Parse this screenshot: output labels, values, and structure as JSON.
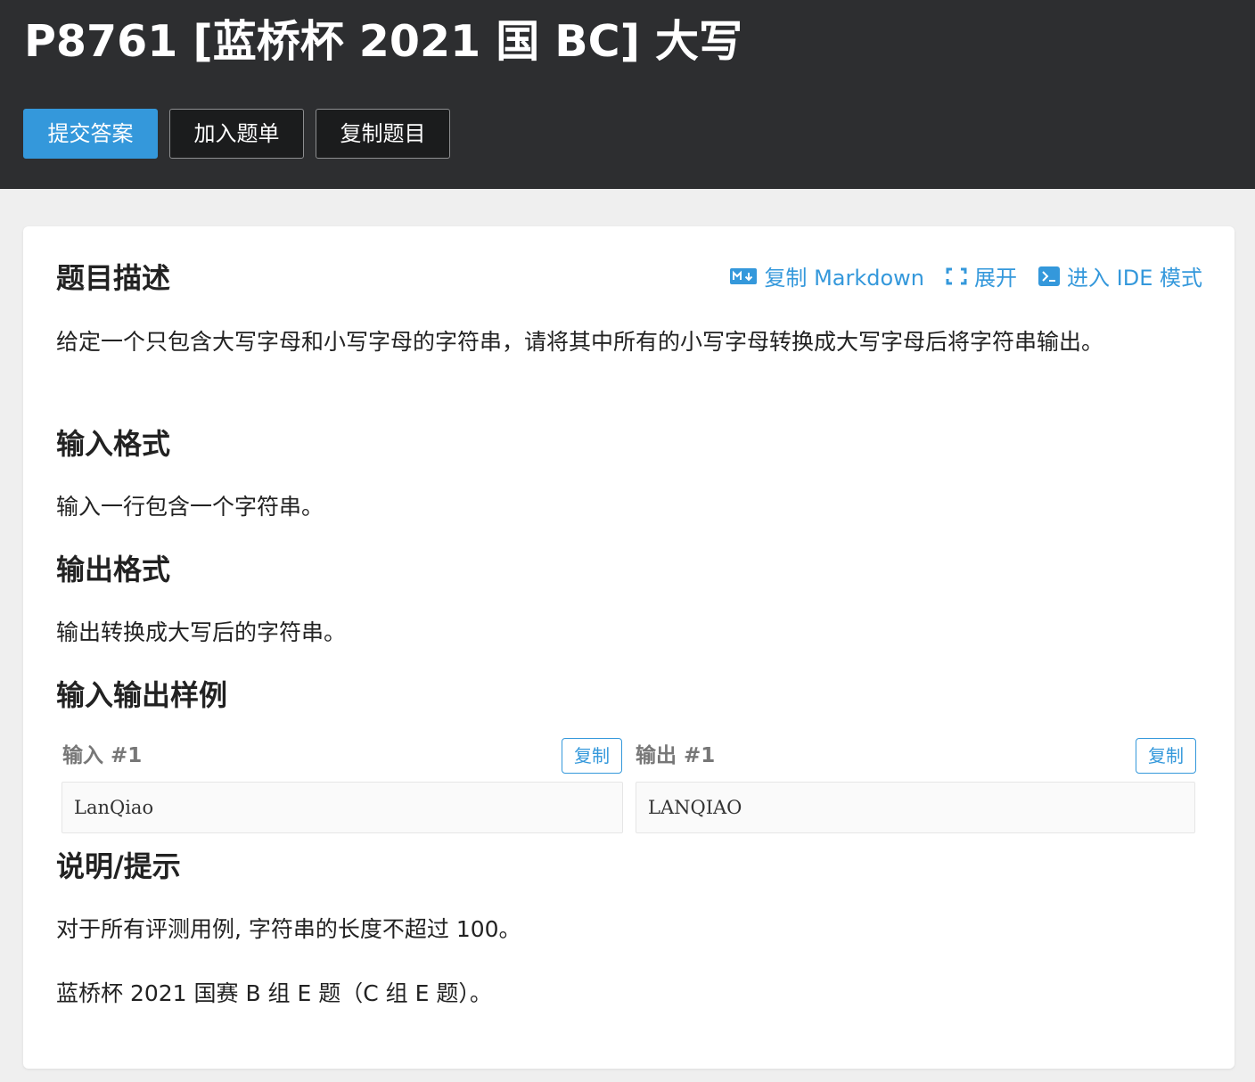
{
  "header": {
    "title": "P8761 [蓝桥杯 2021 国 BC] 大写",
    "buttons": {
      "submit": "提交答案",
      "add_to_list": "加入题单",
      "copy_problem": "复制题目"
    }
  },
  "toolbar": {
    "copy_markdown": "复制 Markdown",
    "expand": "展开",
    "ide_mode": "进入 IDE 模式"
  },
  "sections": {
    "description": {
      "heading": "题目描述",
      "text": "给定一个只包含大写字母和小写字母的字符串，请将其中所有的小写字母转换成大写字母后将字符串输出。"
    },
    "input_format": {
      "heading": "输入格式",
      "text": "输入一行包含一个字符串。"
    },
    "output_format": {
      "heading": "输出格式",
      "text": "输出转换成大写后的字符串。"
    },
    "samples": {
      "heading": "输入输出样例",
      "input_label": "输入 #1",
      "output_label": "输出 #1",
      "copy_label": "复制",
      "input_value": "LanQiao",
      "output_value": "LANQIAO"
    },
    "hint": {
      "heading": "说明/提示",
      "line1": "对于所有评测用例, 字符串的长度不超过 100。",
      "line2": "蓝桥杯 2021 国赛 B 组 E 题（C 组 E 题）。"
    }
  },
  "colors": {
    "header_bg": "#2d2e30",
    "accent": "#3498db",
    "page_bg": "#efefef"
  }
}
